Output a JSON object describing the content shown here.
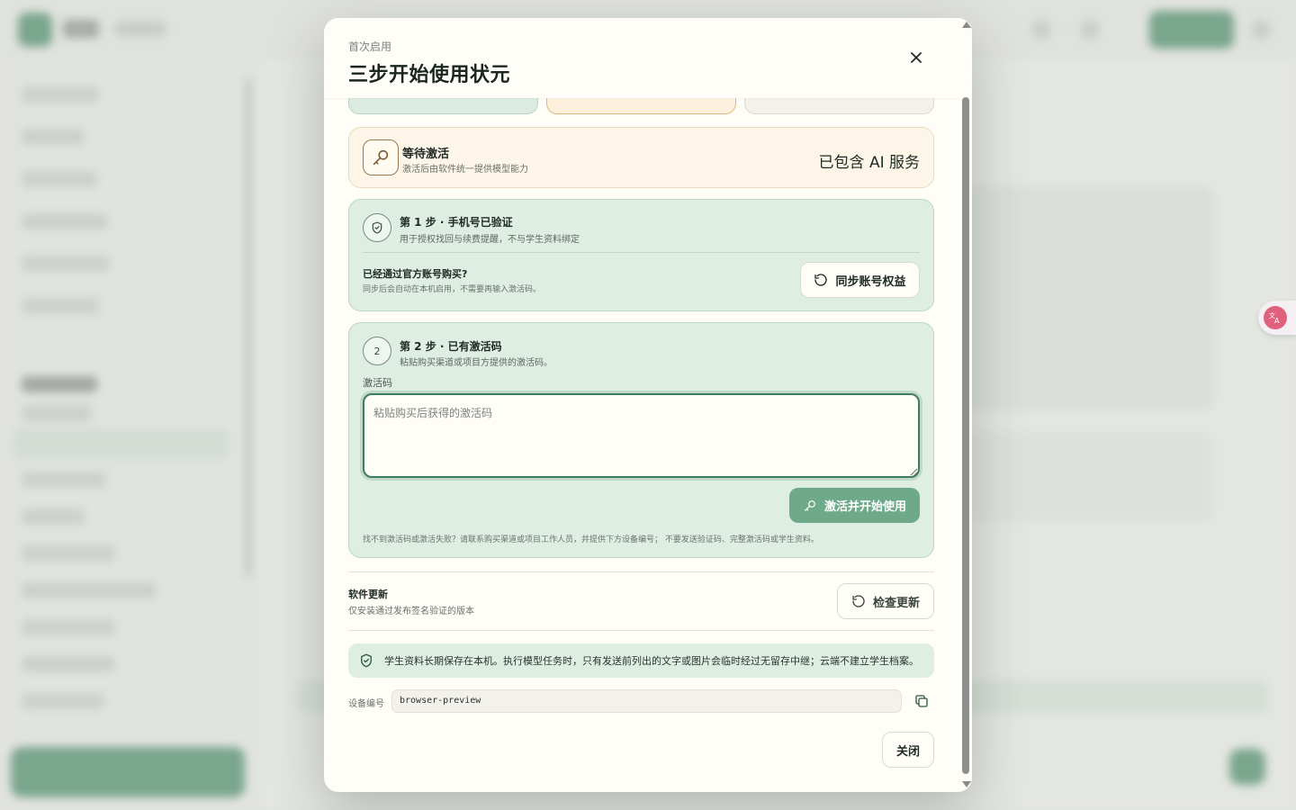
{
  "modal": {
    "kicker": "首次启用",
    "title": "三步开始使用状元"
  },
  "status": {
    "title": "等待激活",
    "subtitle": "激活后由软件统一提供模型能力",
    "badge": "已包含 AI 服务"
  },
  "step1": {
    "title": "第 1 步 · 手机号已验证",
    "subtitle": "用于授权找回与续费提醒，不与学生资料绑定",
    "question": "已经通过官方账号购买?",
    "question_note": "同步后会自动在本机启用，不需要再输入激活码。",
    "sync_button": "同步账号权益"
  },
  "step2": {
    "number": "2",
    "title": "第 2 步 · 已有激活码",
    "subtitle": "粘贴购买渠道或项目方提供的激活码。",
    "field_label": "激活码",
    "placeholder": "粘贴购买后获得的激活码",
    "activate_button": "激活并开始使用",
    "help": "找不到激活码或激活失败？请联系购买渠道或项目工作人员，并提供下方设备编号； 不要发送验证码、完整激活码或学生资料。"
  },
  "update": {
    "title": "软件更新",
    "subtitle": "仅安装通过发布签名验证的版本",
    "check_button": "检查更新"
  },
  "privacy": {
    "text": "学生资料长期保存在本机。执行模型任务时，只有发送前列出的文字或图片会临时经过无留存中继；云端不建立学生档案。"
  },
  "device": {
    "label": "设备编号",
    "value": "browser-preview"
  },
  "footer": {
    "close_button": "关闭"
  },
  "colors": {
    "accent": "#2f7c54",
    "step_bg": "#deeee3",
    "status_bg": "#fdf6e8",
    "activate_bg": "#6ea98a"
  }
}
